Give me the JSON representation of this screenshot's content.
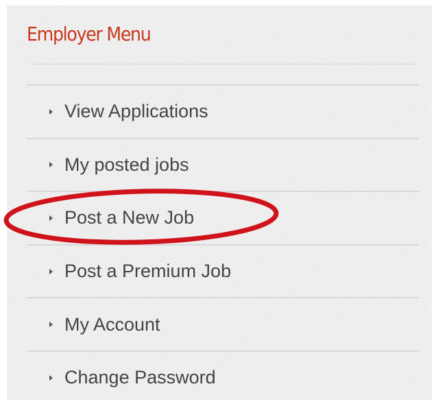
{
  "menu": {
    "title": "Employer Menu",
    "items": [
      {
        "label": "View Applications",
        "icon": "triangle-right-icon",
        "highlighted": false
      },
      {
        "label": "My posted jobs",
        "icon": "triangle-right-icon",
        "highlighted": false
      },
      {
        "label": "Post a New Job",
        "icon": "triangle-right-icon",
        "highlighted": true
      },
      {
        "label": "Post a Premium Job",
        "icon": "triangle-right-icon",
        "highlighted": false
      },
      {
        "label": "My Account",
        "icon": "triangle-right-icon",
        "highlighted": false
      },
      {
        "label": "Change Password",
        "icon": "triangle-right-icon",
        "highlighted": false
      }
    ]
  },
  "colors": {
    "title": "#c8371c",
    "item_text": "#444444",
    "panel_background": "#ebebeb",
    "highlight_ring": "#d0121b"
  }
}
